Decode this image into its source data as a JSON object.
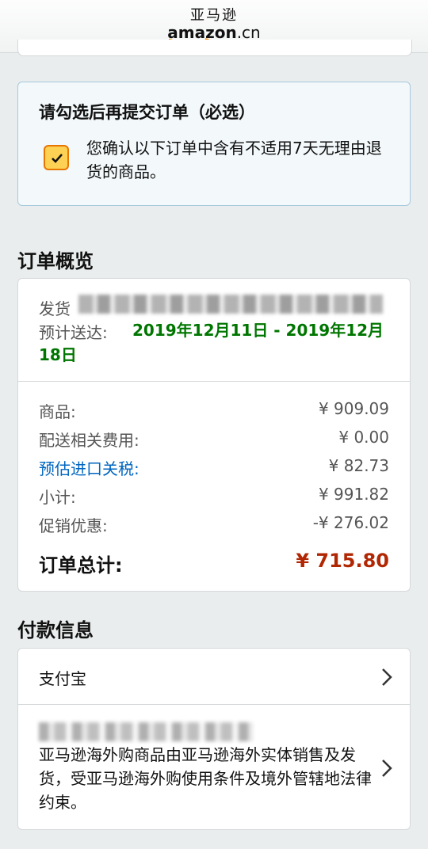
{
  "header": {
    "logo_cn": "亚马逊",
    "logo_en": "amazon",
    "logo_suffix": ".cn"
  },
  "notice": {
    "title": "请勾选后再提交订单（必选）",
    "checked": true,
    "text": "您确认以下订单中含有不适用7天无理由退货的商品。"
  },
  "overview": {
    "title": "订单概览",
    "ship_label": "发货",
    "eta_label": "预计送达:",
    "eta_value": "2019年12月11日 - 2019年12月18日",
    "rows": [
      {
        "label": "商品:",
        "value": "¥ 909.09"
      },
      {
        "label": "配送相关费用:",
        "value": "¥ 0.00"
      },
      {
        "label": "预估进口关税:",
        "value": "¥ 82.73"
      },
      {
        "label": "小计:",
        "value": "¥ 991.82"
      },
      {
        "label": "促销优惠:",
        "value": "-¥ 276.02"
      }
    ],
    "total_label": "订单总计:",
    "total_value": "¥ 715.80"
  },
  "payment": {
    "title": "付款信息",
    "method": "支付宝",
    "terms": "亚马逊海外购商品由亚马逊海外实体销售及发货，受亚马逊海外购使用条件及境外管辖地法律约束。"
  },
  "colors": {
    "accent_green": "#007600",
    "total_red": "#b12704",
    "link_blue": "#0066c0",
    "checkbox_yellow": "#fdd154"
  }
}
